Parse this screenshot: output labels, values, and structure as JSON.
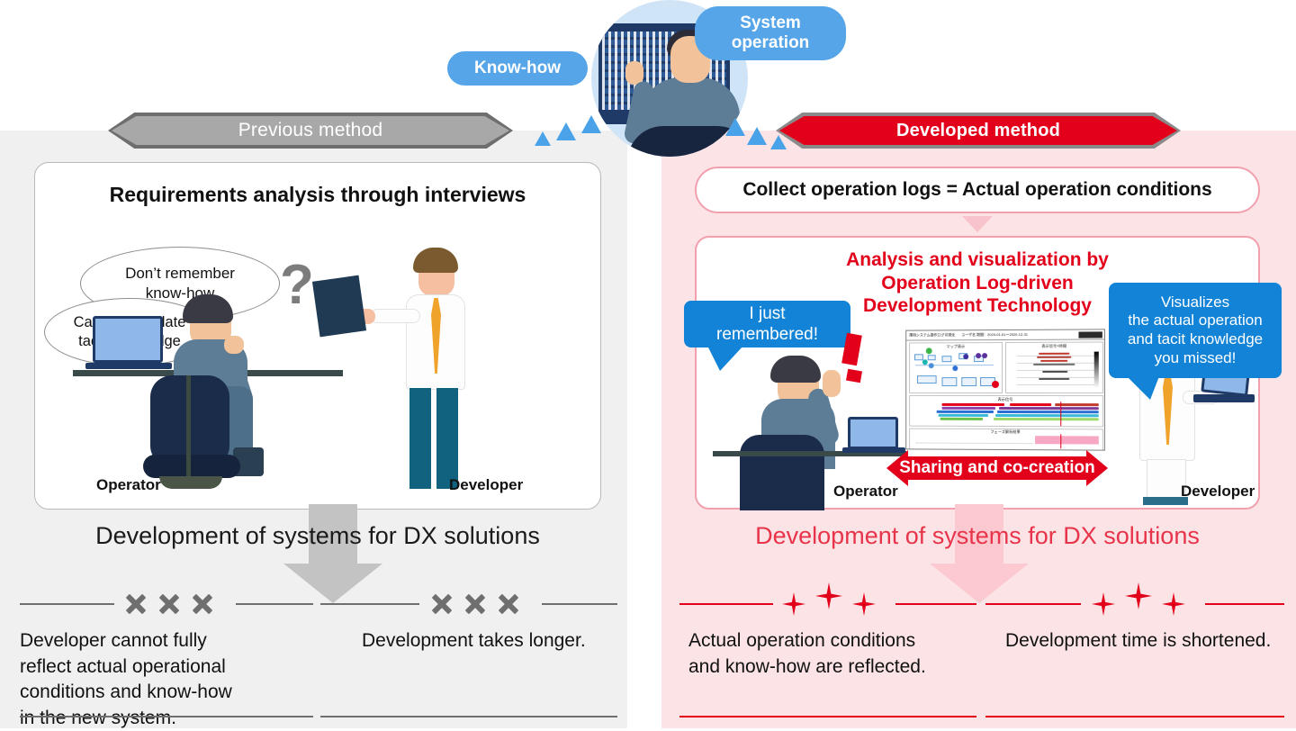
{
  "hero": {
    "badges": [
      {
        "name": "know-how",
        "label": "Know-how"
      },
      {
        "name": "system-operation",
        "label": "System\noperation"
      }
    ],
    "circle_alt": "operator-at-monitor-illustration"
  },
  "left": {
    "banner": "Previous method",
    "card_title": "Requirements analysis through interviews",
    "thought_bubbles": [
      "Don’t remember\nknow-how",
      "Cannot articulate\ntacit knowledge"
    ],
    "question_mark": "?",
    "role_left": "Operator",
    "role_right": "Developer",
    "dx_line": "Development of systems for DX solutions",
    "outcomes": [
      {
        "mark": "x",
        "text": "Developer cannot fully\nreflect actual operational\nconditions and know-how\nin the new system."
      },
      {
        "mark": "x",
        "text": "Development takes longer."
      }
    ]
  },
  "right": {
    "banner": "Developed method",
    "collect_box": "Collect operation logs = Actual operation conditions",
    "analysis_title": "Analysis and visualization by\nOperation Log-driven\nDevelopment Technology",
    "speech_left": "I just\nremembered!",
    "speech_right": "Visualizes\nthe actual operation\nand tacit knowledge\nyou missed!",
    "exclamation": "!",
    "share_arrow": "Sharing and co-creation",
    "role_left": "Operator",
    "role_right": "Developer",
    "dx_line": "Development of systems for DX solutions",
    "outcomes": [
      {
        "mark": "star",
        "text": "Actual operation conditions\n and know-how are reflected."
      },
      {
        "mark": "star",
        "text": "Development time is shortened."
      }
    ]
  },
  "dashboard": {
    "title": "運用システム操作ログ可視化",
    "subtitle": "ユーザ名  期間：2020-01-01～2020-12-31",
    "panels": [
      {
        "name": "map-view",
        "caption": "マップ表示"
      },
      {
        "name": "signal-time",
        "caption": "表示信号×時間"
      },
      {
        "name": "signal-timeline",
        "caption": "表示信号"
      },
      {
        "name": "phase-analysis",
        "caption": "フェーズ解析結果"
      }
    ]
  },
  "colors": {
    "left_panel_bg": "#f0f0f0",
    "right_panel_bg": "#fce4e6",
    "accent_red": "#e2001a",
    "accent_blue": "#1283d6",
    "badge_blue": "#56a5e8",
    "banner_gray": "#a8a8a8",
    "pink_arrow": "#fbc9cf",
    "gray_arrow": "#c3c3c3"
  }
}
